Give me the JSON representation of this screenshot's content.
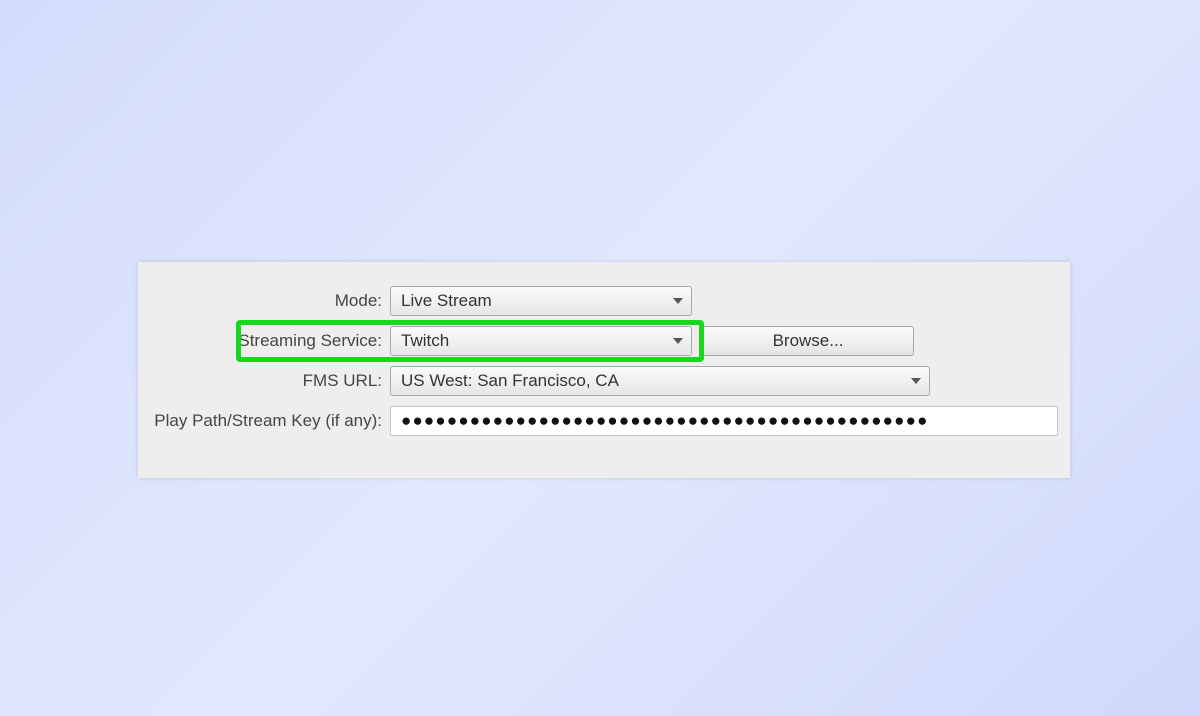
{
  "form": {
    "mode": {
      "label": "Mode:",
      "value": "Live Stream"
    },
    "service": {
      "label": "Streaming Service:",
      "value": "Twitch",
      "browse_label": "Browse..."
    },
    "fms": {
      "label": "FMS URL:",
      "value": "US West: San Francisco, CA"
    },
    "streamkey": {
      "label": "Play Path/Stream Key (if any):",
      "value": "●●●●●●●●●●●●●●●●●●●●●●●●●●●●●●●●●●●●●●●●●●●●●●"
    }
  }
}
